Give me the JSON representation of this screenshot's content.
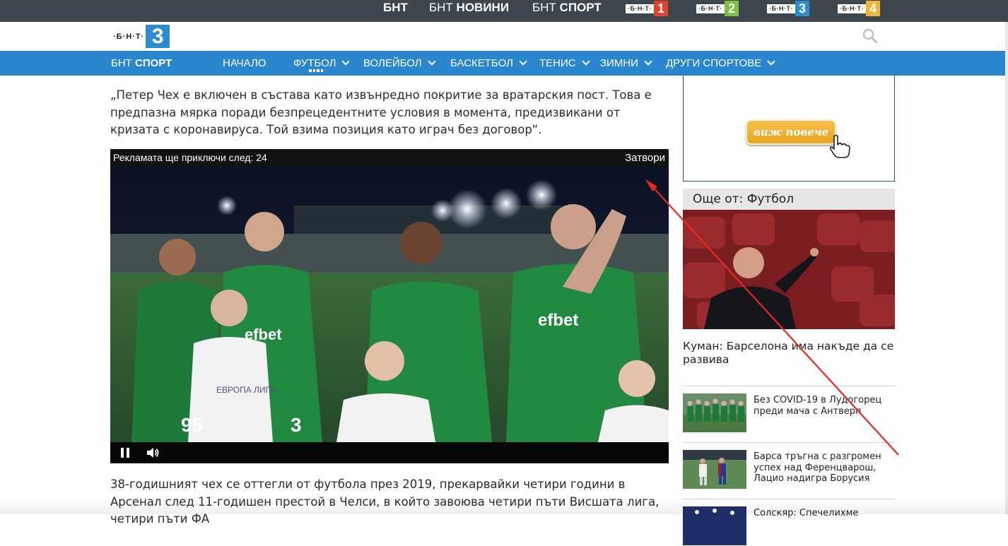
{
  "topbar": {
    "links": [
      {
        "pre": "",
        "bold": "БНТ"
      },
      {
        "pre": "БНТ ",
        "bold": "НОВИНИ"
      },
      {
        "pre": "БНТ ",
        "bold": "СПОРТ"
      }
    ],
    "channels": [
      {
        "brand": "·Б·Н·Т·",
        "num": "1",
        "color": "#e2422b"
      },
      {
        "brand": "·Б·Н·Т·",
        "num": "2",
        "color": "#7cc142"
      },
      {
        "brand": "·Б·Н·Т·",
        "num": "3",
        "color": "#2e8bd0"
      },
      {
        "brand": "·Б·Н·Т·",
        "num": "4",
        "color": "#f4b43a"
      }
    ]
  },
  "logo": {
    "brand": "·Б·Н·Т·",
    "num": "3"
  },
  "nav": {
    "brand_pre": "БНТ ",
    "brand_bold": "СПОРТ",
    "items": [
      "НАЧАЛО",
      "ФУТБОЛ",
      "ВОЛЕЙБОЛ",
      "БАСКЕТБОЛ",
      "ТЕНИС",
      "ЗИМНИ",
      "ДРУГИ СПОРТОВЕ"
    ]
  },
  "article": {
    "p1": "„Петер Чех е включен в състава като извънредно покритие за вратарския пост. Това е предпазна мярка поради безпрецедентните условия в момента, предизвикани от кризата с коронавируса. Той взима позиция като играч без договор“.",
    "p2": "38-годишният чех се оттегли от футбола през 2019, прекарвайки четири години в Арсенал след 11-годишен престой в Челси, в който завоюва четири пъти Висшата лига, четири пъти ФА"
  },
  "video": {
    "countdown_label": "Рекламата ще приключи след: 24",
    "close_label": "Затвори",
    "shirt_sponsor": "efbet",
    "shirt_numbers": [
      "95",
      "3"
    ],
    "kid_shirt_text": "ЕВРОПА\nЛИГА"
  },
  "sidebar": {
    "ad_button": "виж повече",
    "more_heading": "Още от: Футбол",
    "main_story": "Куман: Барселона има накъде да се развива",
    "stories": [
      "Без COVID-19 в Лудогорец преди мача с Антверп",
      "Барса тръгна с разгромен успех над Ференцварош, Лацио надигра Борусия",
      "Солскяр: Спечелихме"
    ]
  },
  "colors": {
    "topbar": "#3d474d",
    "nav": "#2b87cd",
    "annotation_arrow": "#e8281e"
  }
}
